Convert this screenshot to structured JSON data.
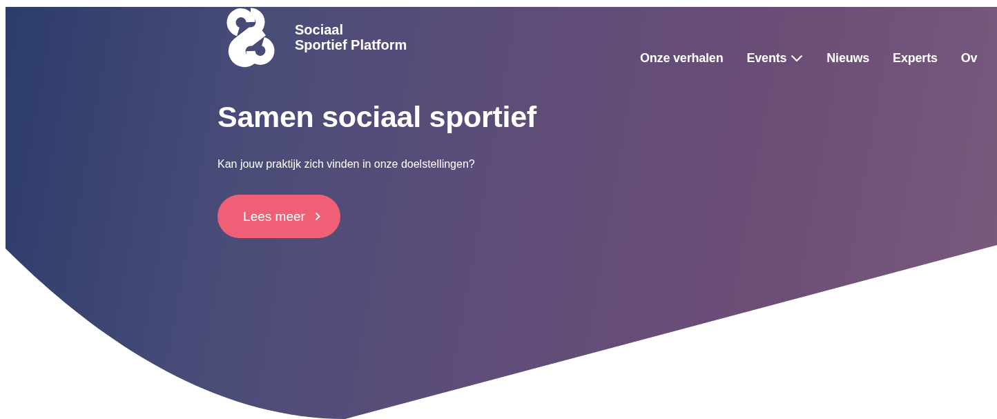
{
  "logo": {
    "line_1": "Sociaal",
    "line_2": "Sportief Platform"
  },
  "nav": [
    {
      "label": "Onze verhalen",
      "kind": "link"
    },
    {
      "label": "Events",
      "kind": "dropdown"
    },
    {
      "label": "Nieuws",
      "kind": "link"
    },
    {
      "label": "Experts",
      "kind": "link"
    },
    {
      "label": "Ov",
      "kind": "link"
    }
  ],
  "hero": {
    "title": "Samen sociaal sportief",
    "subtitle": "Kan jouw praktijk zich vinden in onze doelstellingen?",
    "button": "Lees meer"
  }
}
